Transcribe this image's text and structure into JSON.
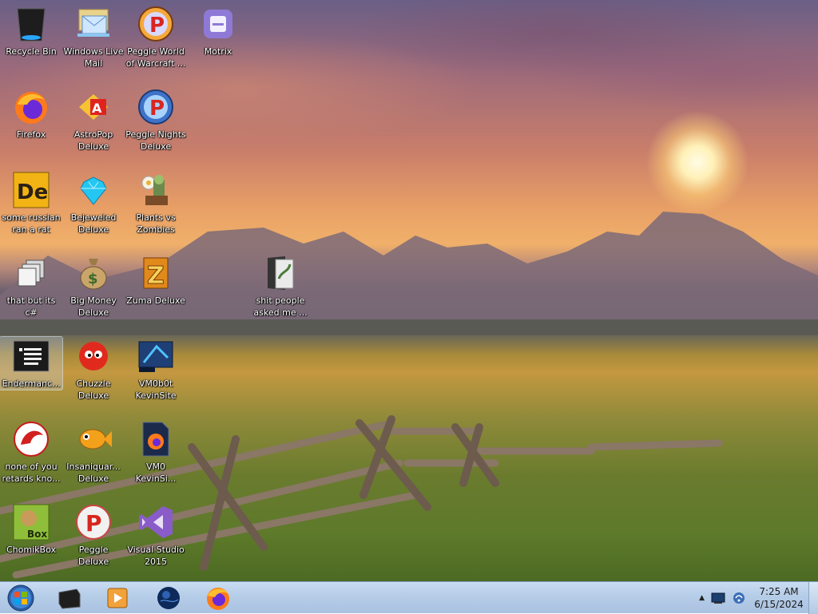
{
  "desktop": {
    "icons": [
      {
        "label": "Recycle Bin",
        "icon": "recycle-bin-icon"
      },
      {
        "label": "Windows Live\nMail",
        "icon": "mail-icon"
      },
      {
        "label": "Peggle World\nof Warcraft ...",
        "icon": "peggle-wow-icon"
      },
      {
        "label": "Motrix",
        "icon": "motrix-icon"
      },
      {
        "label": "Firefox",
        "icon": "firefox-icon"
      },
      {
        "label": "AstroPop\nDeluxe",
        "icon": "astropop-icon"
      },
      {
        "label": "Peggle Nights\nDeluxe",
        "icon": "peggle-nights-icon"
      },
      {
        "label": "some russian\nran a rat",
        "icon": "de-icon"
      },
      {
        "label": "Bejeweled\nDeluxe",
        "icon": "gem-icon"
      },
      {
        "label": "Plants vs\nZombies",
        "icon": "plants-icon"
      },
      {
        "label": "that but its c#",
        "icon": "stacked-windows-icon"
      },
      {
        "label": "Big Money\nDeluxe",
        "icon": "money-bag-icon"
      },
      {
        "label": "Zuma Deluxe",
        "icon": "zuma-icon"
      },
      {
        "label": "shit people\nasked me ...",
        "icon": "folder-icon"
      },
      {
        "label": "Endermanc...",
        "icon": "console-icon"
      },
      {
        "label": "Chuzzle\nDeluxe",
        "icon": "chuzzle-icon"
      },
      {
        "label": "VM0b0t\nKevinSite",
        "icon": "vm-icon"
      },
      {
        "label": "none of you\nretards kno...",
        "icon": "red-dragon-icon"
      },
      {
        "label": "Insaniquar...\nDeluxe",
        "icon": "fish-icon"
      },
      {
        "label": "VM0\nKevinSi...",
        "icon": "firefox-file-icon"
      },
      {
        "label": "ChomikBox",
        "icon": "chomikbox-icon"
      },
      {
        "label": "Peggle Deluxe",
        "icon": "peggle-icon"
      },
      {
        "label": "Visual Studio\n2015",
        "icon": "visual-studio-icon"
      }
    ]
  },
  "taskbar": {
    "start": "start-orb-icon",
    "pinned": [
      "media-center-icon",
      "media-player-icon",
      "globe-icon",
      "firefox-icon"
    ],
    "tray": {
      "time": "7:25 AM",
      "date": "6/15/2024"
    }
  }
}
